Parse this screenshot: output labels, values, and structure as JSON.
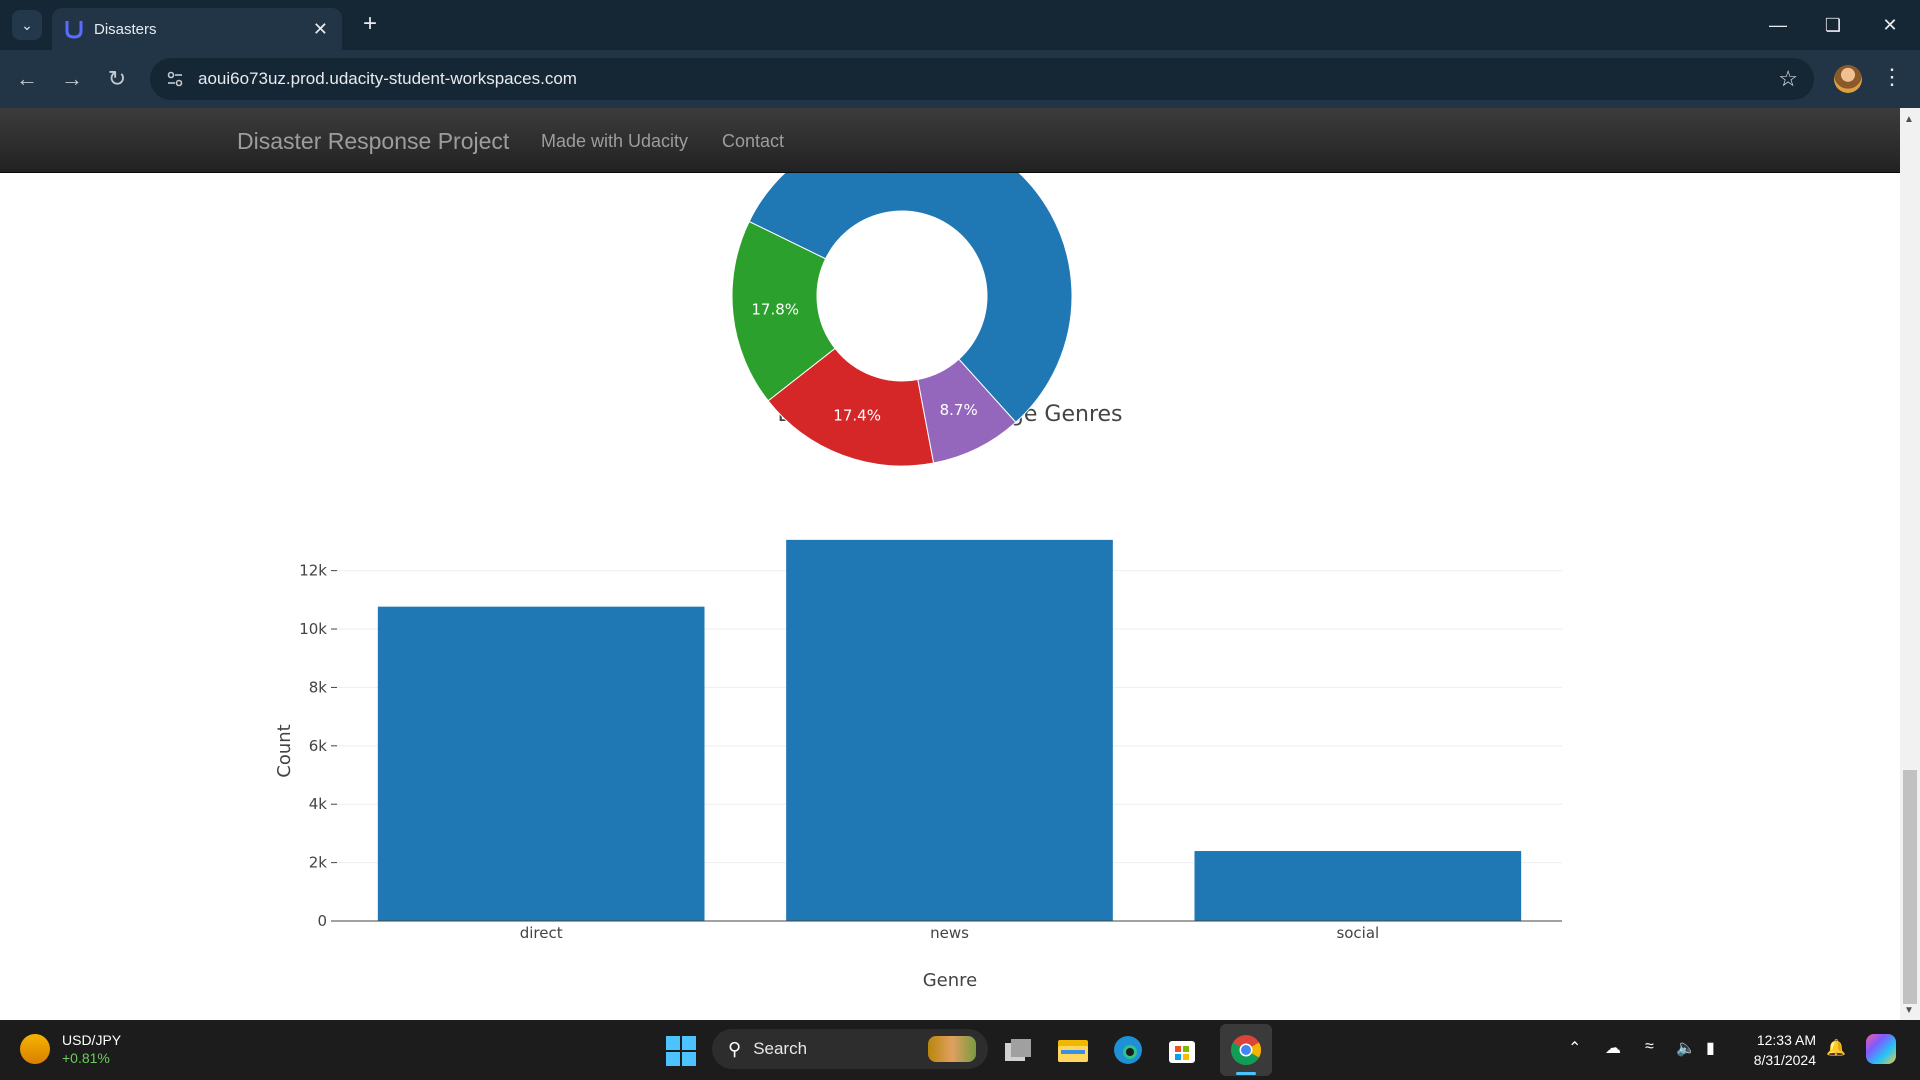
{
  "browser": {
    "tab_title": "Disasters",
    "url": "aoui6o73uz.prod.udacity-student-workspaces.com",
    "icons": {
      "tab_list": "chevron-down-icon",
      "tab_close": "close-icon",
      "new_tab": "plus-icon",
      "back": "arrow-left-icon",
      "forward": "arrow-right-icon",
      "reload": "reload-icon",
      "site_info": "site-settings-icon",
      "bookmark": "star-icon",
      "menu": "more-vert-icon"
    }
  },
  "site_nav": {
    "brand": "Disaster Response Project",
    "links": [
      "Made with Udacity",
      "Contact"
    ]
  },
  "charts": {
    "chart_data": [
      {
        "type": "pie",
        "hole": true,
        "slices": [
          {
            "label_text": "17.8%",
            "value": 17.8,
            "color": "#2ca02c"
          },
          {
            "label_text": "17.4%",
            "value": 17.4,
            "color": "#d62728"
          },
          {
            "label_text": "8.7%",
            "value": 8.7,
            "color": "#9467bd"
          },
          {
            "label_text": "",
            "value": 56.1,
            "color": "#1f77b4"
          }
        ],
        "partially_visible": true
      },
      {
        "type": "bar",
        "title": "Distribution of Message Genres",
        "xlabel": "Genre",
        "ylabel": "Count",
        "categories": [
          "direct",
          "news",
          "social"
        ],
        "values": [
          10766,
          13054,
          2396
        ],
        "ylim": [
          0,
          13700
        ],
        "yticks": [
          0,
          2000,
          4000,
          6000,
          8000,
          10000,
          12000
        ],
        "ytick_labels": [
          "0",
          "2k",
          "4k",
          "6k",
          "8k",
          "10k",
          "12k"
        ],
        "bar_color": "#1f77b4",
        "grid": true
      }
    ]
  },
  "taskbar": {
    "widget_symbol": "USD/JPY",
    "widget_change": "+0.81%",
    "search_label": "Search",
    "clock_time": "12:33 AM",
    "clock_date": "8/31/2024",
    "accent_color": "#4cc2ff"
  }
}
